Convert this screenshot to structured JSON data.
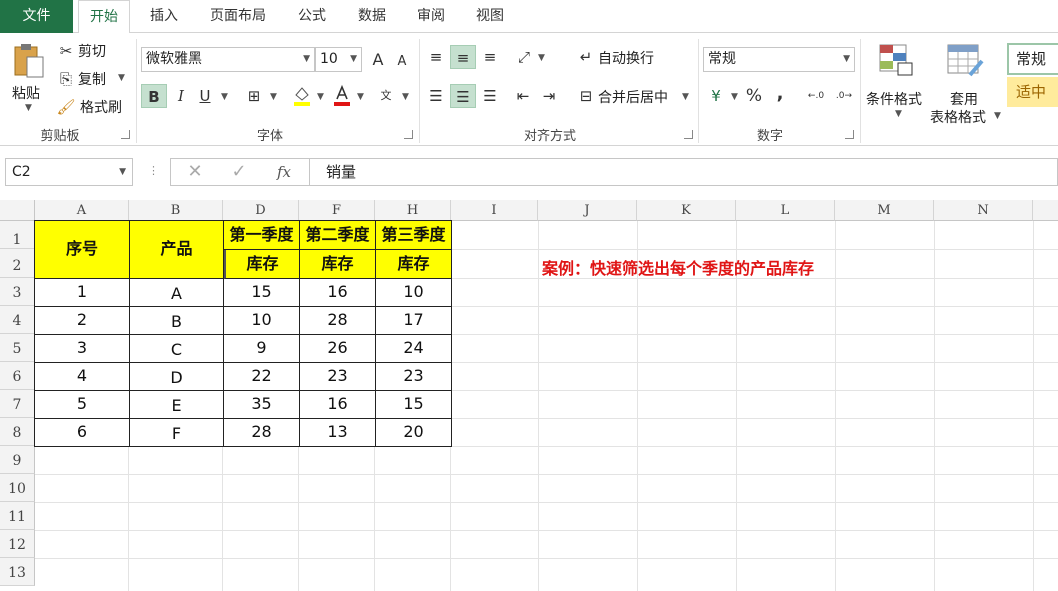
{
  "tabs": [
    {
      "label": "文件",
      "id": "file"
    },
    {
      "label": "开始",
      "id": "home",
      "active": true
    },
    {
      "label": "插入",
      "id": "insert"
    },
    {
      "label": "页面布局",
      "id": "page-layout"
    },
    {
      "label": "公式",
      "id": "formulas"
    },
    {
      "label": "数据",
      "id": "data"
    },
    {
      "label": "审阅",
      "id": "review"
    },
    {
      "label": "视图",
      "id": "view"
    }
  ],
  "clipboard": {
    "paste": "粘贴",
    "cut": "剪切",
    "copy": "复制",
    "format_painter": "格式刷",
    "group": "剪贴板"
  },
  "font": {
    "name": "微软雅黑",
    "size": "10",
    "group": "字体",
    "bold": "B",
    "italic": "I",
    "underline": "U",
    "grow": "A",
    "shrink": "A"
  },
  "alignment": {
    "wrap": "自动换行",
    "merge": "合并后居中",
    "group": "对齐方式"
  },
  "number": {
    "format": "常规",
    "percent": "%",
    "comma": ",",
    "group": "数字"
  },
  "styles": {
    "conditional": "条件格式",
    "table_format_1": "套用",
    "table_format_2": "表格格式",
    "style_normal": "常规",
    "style_neutral": "适中"
  },
  "formula_bar": {
    "name_box": "C2",
    "content": "销量",
    "fx": "fx"
  },
  "columns": [
    "A",
    "B",
    "D",
    "F",
    "H",
    "I",
    "J",
    "K",
    "L",
    "M",
    "N"
  ],
  "rows": [
    "1",
    "2",
    "3",
    "4",
    "5",
    "6",
    "7",
    "8",
    "9",
    "10",
    "11",
    "12",
    "13"
  ],
  "table": {
    "header_seq": "序号",
    "header_product": "产品",
    "quarters": [
      "第一季度",
      "第二季度",
      "第三季度"
    ],
    "sub_header": [
      "库存",
      "库存",
      "库存"
    ],
    "rows": [
      [
        "1",
        "A",
        "15",
        "16",
        "10"
      ],
      [
        "2",
        "B",
        "10",
        "28",
        "17"
      ],
      [
        "3",
        "C",
        "9",
        "26",
        "24"
      ],
      [
        "4",
        "D",
        "22",
        "23",
        "23"
      ],
      [
        "5",
        "E",
        "35",
        "16",
        "15"
      ],
      [
        "6",
        "F",
        "28",
        "13",
        "20"
      ]
    ]
  },
  "note": "案例：快速筛选出每个季度的产品库存",
  "colors": {
    "accent": "#217346",
    "highlight": "#ffff00",
    "note": "#e01515"
  }
}
